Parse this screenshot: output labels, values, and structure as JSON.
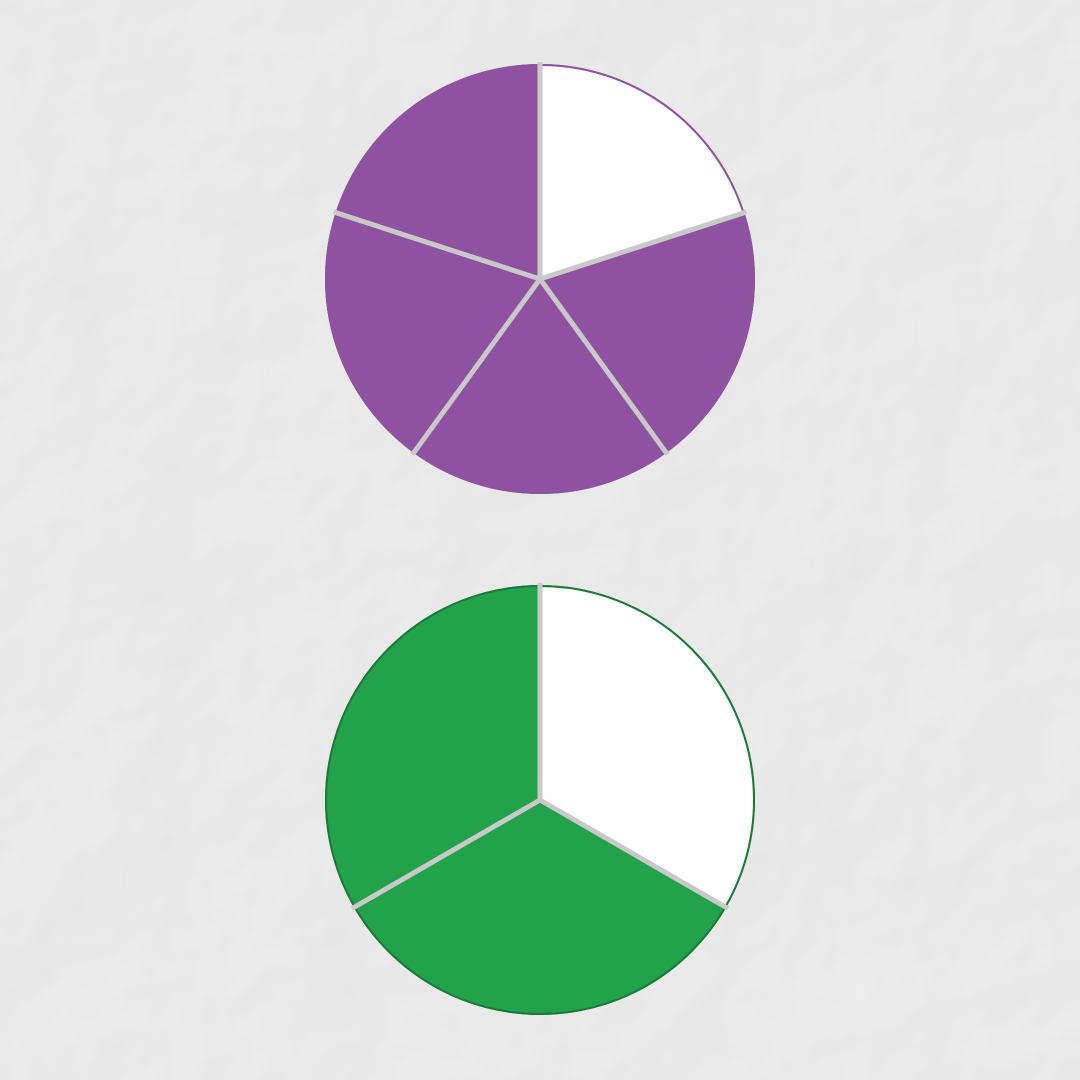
{
  "background": {
    "texture": "crumpled-paper",
    "base_color": "#e6e6e6"
  },
  "fraction_circles": [
    {
      "name": "purple-fifths-circle",
      "parts": 5,
      "unshaded_parts": 1,
      "shaded_color": "#8e52a0",
      "outline_color": "#8e52a0",
      "unshaded_color": "#ffffff",
      "divider_color": "#c9c9c9",
      "unshaded_position": "top-right"
    },
    {
      "name": "green-thirds-circle",
      "parts": 3,
      "unshaded_parts": 1,
      "shaded_color": "#22a34b",
      "outline_color": "#1a7a38",
      "unshaded_color": "#ffffff",
      "divider_color": "#c9c9c9",
      "unshaded_position": "top-right"
    }
  ]
}
